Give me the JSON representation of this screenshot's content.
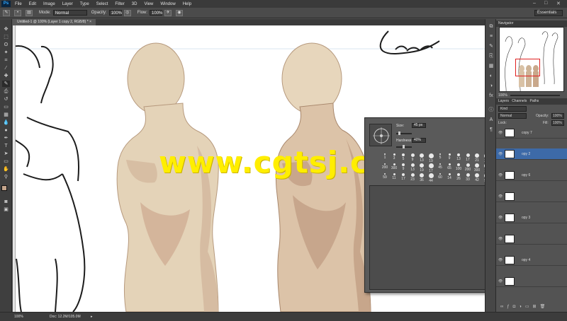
{
  "menubar": {
    "logo": "Ps",
    "items": [
      "File",
      "Edit",
      "Image",
      "Layer",
      "Type",
      "Select",
      "Filter",
      "3D",
      "View",
      "Window",
      "Help"
    ],
    "window_controls": [
      "–",
      "□",
      "✕"
    ]
  },
  "options": {
    "mode_label": "Mode:",
    "mode_value": "Normal",
    "opacity_label": "Opacity:",
    "opacity_value": "100%",
    "flow_label": "Flow:",
    "flow_value": "100%",
    "workspace": "Essentials"
  },
  "document_tab": {
    "title": "Untitled-1 @ 100% (Layer 1 copy 2, RGB/8) *",
    "close": "×"
  },
  "navigator": {
    "tabs": "Navigator",
    "zoom": "100%"
  },
  "layers_panel": {
    "tabs": [
      "Layers",
      "Channels",
      "Paths"
    ],
    "kind_filter": "Kind",
    "blend_mode": "Normal",
    "opacity_label": "Opacity:",
    "opacity_value": "100%",
    "lock_label": "Lock:",
    "fill_label": "Fill:",
    "fill_value": "100%",
    "layers": [
      {
        "name": "copy 7",
        "active": false
      },
      {
        "name": "opy 2",
        "active": true
      },
      {
        "name": "opy 6",
        "active": false
      },
      {
        "name": "",
        "active": false
      },
      {
        "name": "opy 3",
        "active": false
      },
      {
        "name": "",
        "active": false
      },
      {
        "name": "opy 4",
        "active": false
      },
      {
        "name": "",
        "active": false
      }
    ]
  },
  "status": {
    "zoom": "100%",
    "doc": "Doc: 12.2M/105.0M"
  },
  "brush_popup": {
    "size_label": "Size:",
    "size_value": "45 px",
    "hardness_label": "Hardness:",
    "hardness_value": "40%",
    "size_fraction": 0.12,
    "hardness_fraction": 0.4,
    "brushes_row1": [
      "1",
      "3",
      "5",
      "9",
      "13",
      "19",
      "5",
      "9",
      "13",
      "17",
      "21",
      "27",
      "35",
      "45",
      "65",
      "100"
    ],
    "brushes_row2": [
      "200",
      "300",
      "9",
      "13",
      "19",
      "17",
      "45",
      "65",
      "100",
      "200",
      "300",
      "14",
      "24",
      "27",
      "39",
      "46"
    ],
    "brushes_row3": [
      "59",
      "11",
      "17",
      "23",
      "36",
      "44",
      "60",
      "14",
      "26",
      "33",
      "42",
      "55",
      "70",
      "112",
      "134",
      "74"
    ],
    "brushes_row4": [
      "95",
      "29",
      "192",
      "36",
      "33",
      "63",
      "66",
      "39",
      "63",
      "11",
      "48",
      "32",
      "55",
      "100",
      "75",
      "45"
    ],
    "brushes_row5": [
      "1106",
      "1063",
      "1106",
      "1105",
      "1107",
      "1105",
      "1106",
      "1106",
      "1107",
      "1105",
      "1106",
      "1106",
      "1106",
      "1106",
      "1106",
      "1106"
    ]
  },
  "watermark": "www.cgtsj.com",
  "colors": {
    "skin_light": "#e8d9c0",
    "skin_shadow": "#c9a98e",
    "ui_dark": "#3a3a3a",
    "watermark": "#ffee00",
    "selection": "#3d6aa8"
  }
}
